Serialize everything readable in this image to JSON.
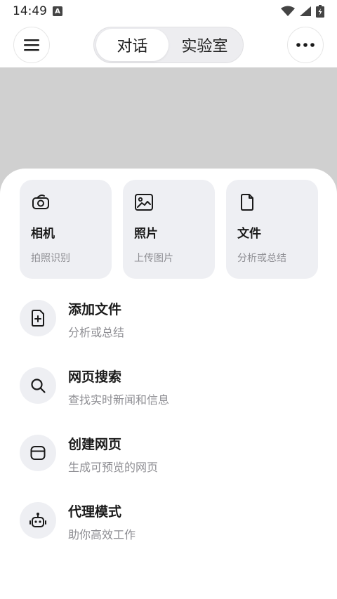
{
  "status": {
    "time": "14:49",
    "app_indicator": "A"
  },
  "header": {
    "tabs": [
      {
        "label": "对话",
        "active": true
      },
      {
        "label": "实验室",
        "active": false
      }
    ]
  },
  "cards": [
    {
      "title": "相机",
      "subtitle": "拍照识别",
      "icon": "camera-icon"
    },
    {
      "title": "照片",
      "subtitle": "上传图片",
      "icon": "image-icon"
    },
    {
      "title": "文件",
      "subtitle": "分析或总结",
      "icon": "file-icon"
    }
  ],
  "list": [
    {
      "title": "添加文件",
      "subtitle": "分析或总结",
      "icon": "add-file-icon"
    },
    {
      "title": "网页搜索",
      "subtitle": "查找实时新闻和信息",
      "icon": "search-icon"
    },
    {
      "title": "创建网页",
      "subtitle": "生成可预览的网页",
      "icon": "webpage-icon"
    },
    {
      "title": "代理模式",
      "subtitle": "助你高效工作",
      "icon": "robot-icon"
    }
  ]
}
